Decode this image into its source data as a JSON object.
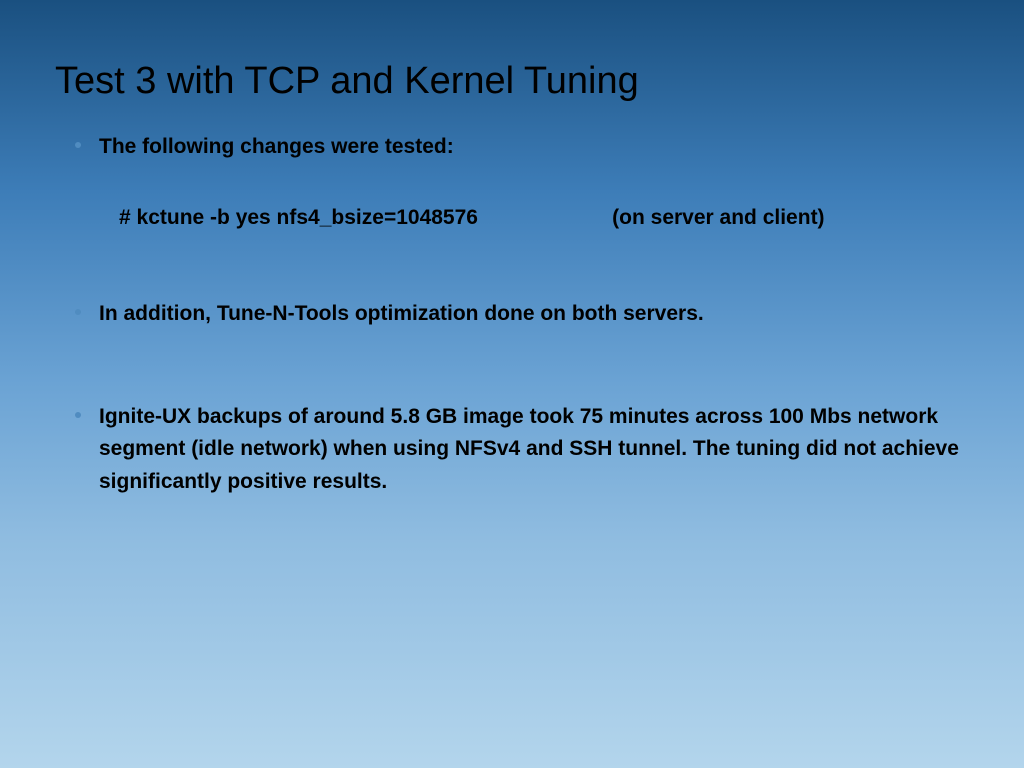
{
  "title": "Test 3 with TCP and Kernel Tuning",
  "bullets": {
    "item1": "The following changes were tested:",
    "code_cmd": "# kctune -b yes nfs4_bsize=1048576",
    "code_note": "                       (on server and client)",
    "item2": "In addition, Tune-N-Tools optimization done on both servers.",
    "item3": "Ignite-UX backups of around 5.8 GB image took 75 minutes across 100 Mbs network segment (idle network) when using NFSv4 and SSH tunnel. The tuning did not achieve significantly positive results."
  }
}
